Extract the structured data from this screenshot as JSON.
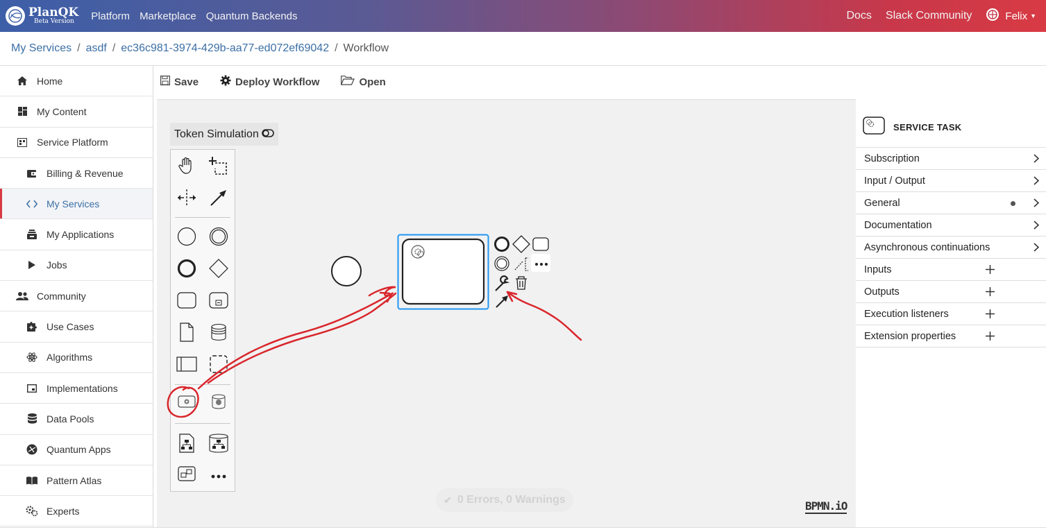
{
  "topbar": {
    "brand": "PlanQK",
    "brand_sub": "Beta Version",
    "nav": [
      "Platform",
      "Marketplace",
      "Quantum Backends"
    ],
    "right_links": [
      "Docs",
      "Slack Community"
    ],
    "user": "Felix"
  },
  "breadcrumb": [
    "My Services",
    "asdf",
    "ec36c981-3974-429b-aa77-ed072ef69042",
    "Workflow"
  ],
  "sidebar": {
    "items": [
      {
        "label": "Home",
        "icon": "home-icon"
      },
      {
        "label": "My Content",
        "icon": "dashboard-icon"
      },
      {
        "label": "Service Platform",
        "icon": "calendar-icon"
      },
      {
        "label": "Billing & Revenue",
        "icon": "wallet-icon"
      },
      {
        "label": "My Services",
        "icon": "code-icon",
        "active": true
      },
      {
        "label": "My Applications",
        "icon": "app-stack-icon"
      },
      {
        "label": "Jobs",
        "icon": "play-icon"
      },
      {
        "label": "Community",
        "icon": "people-icon"
      },
      {
        "label": "Use Cases",
        "icon": "puzzle-icon"
      },
      {
        "label": "Algorithms",
        "icon": "atom-icon"
      },
      {
        "label": "Implementations",
        "icon": "window-icon"
      },
      {
        "label": "Data Pools",
        "icon": "database-icon"
      },
      {
        "label": "Quantum Apps",
        "icon": "quantum-icon"
      },
      {
        "label": "Pattern Atlas",
        "icon": "book-icon"
      },
      {
        "label": "Experts",
        "icon": "experts-icon"
      }
    ]
  },
  "toolbar": {
    "save": "Save",
    "deploy": "Deploy Workflow",
    "open": "Open"
  },
  "canvas": {
    "token_simulation": "Token Simulation",
    "status": "0 Errors, 0 Warnings",
    "watermark": "BPMN.iO"
  },
  "panel": {
    "title": "SERVICE TASK",
    "groups": [
      {
        "label": "Subscription",
        "action": "chevron"
      },
      {
        "label": "Input / Output",
        "action": "chevron"
      },
      {
        "label": "General",
        "action": "chevron",
        "dot": true
      },
      {
        "label": "Documentation",
        "action": "chevron"
      },
      {
        "label": "Asynchronous continuations",
        "action": "chevron"
      },
      {
        "label": "Inputs",
        "action": "plus"
      },
      {
        "label": "Outputs",
        "action": "plus"
      },
      {
        "label": "Execution listeners",
        "action": "plus"
      },
      {
        "label": "Extension properties",
        "action": "plus"
      }
    ]
  },
  "colors": {
    "accent": "#d83a44",
    "link": "#3b6fa6",
    "selection": "#2196f3",
    "annotation": "#d9262c"
  }
}
